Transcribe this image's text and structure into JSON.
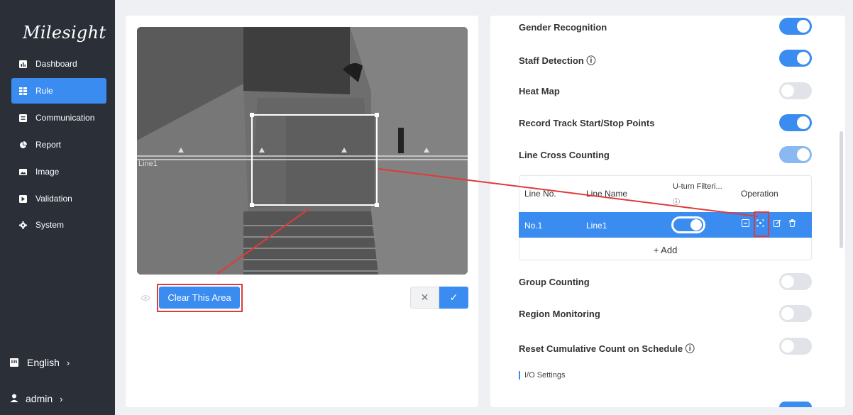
{
  "brand": {
    "logo_text": "Milesight"
  },
  "sidebar": {
    "items": [
      {
        "label": "Dashboard",
        "icon": "bar-chart-icon"
      },
      {
        "label": "Rule",
        "icon": "grid-icon",
        "active": true
      },
      {
        "label": "Communication",
        "icon": "message-icon"
      },
      {
        "label": "Report",
        "icon": "pie-chart-icon"
      },
      {
        "label": "Image",
        "icon": "image-icon"
      },
      {
        "label": "Validation",
        "icon": "validation-icon"
      },
      {
        "label": "System",
        "icon": "gear-icon"
      }
    ],
    "language": {
      "label": "English",
      "badge": "EN"
    },
    "user": {
      "label": "admin"
    }
  },
  "video": {
    "line_label": "Line1"
  },
  "area_controls": {
    "clear_label": "Clear This Area",
    "cancel_symbol": "✕",
    "confirm_symbol": "✓"
  },
  "settings": [
    {
      "label": "Gender Recognition",
      "state": "on"
    },
    {
      "label": "Staff Detection ⓘ",
      "state": "on"
    },
    {
      "label": "Heat Map",
      "state": "off"
    },
    {
      "label": "Record Track Start/Stop Points",
      "state": "on"
    },
    {
      "label": "Line Cross Counting",
      "state": "on-disabled"
    },
    {
      "label": "Group Counting",
      "state": "off"
    },
    {
      "label": "Region Monitoring",
      "state": "off"
    },
    {
      "label": "Reset Cumulative Count on Schedule ⓘ",
      "state": "off"
    }
  ],
  "line_table": {
    "headers": {
      "line_no": "Line No.",
      "line_name": "Line Name",
      "uturn": "U-turn Filteri...",
      "uturn_info": "ⓘ",
      "operation": "Operation"
    },
    "rows": [
      {
        "line_no": "No.1",
        "line_name": "Line1",
        "uturn": "on"
      }
    ],
    "add_label": "+ Add"
  },
  "io_settings": {
    "label": "I/O Settings"
  },
  "colors": {
    "accent": "#3b8cf0",
    "sidebar_bg": "#2b2f38",
    "highlight_red": "#e03a3a"
  }
}
